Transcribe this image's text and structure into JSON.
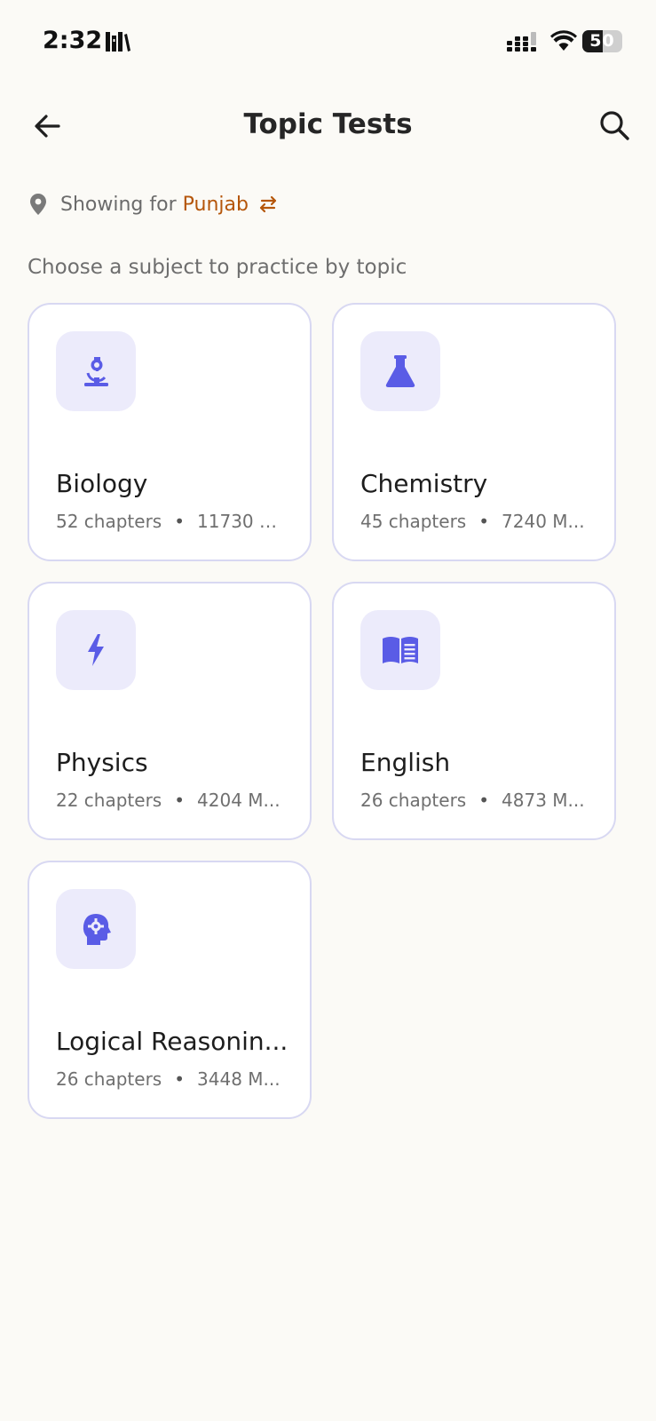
{
  "status_bar": {
    "time": "2:32",
    "battery": "50"
  },
  "header": {
    "title": "Topic Tests"
  },
  "location": {
    "prefix": "Showing for",
    "region": "Punjab"
  },
  "subtitle": "Choose a subject to practice by topic",
  "subjects": [
    {
      "name": "Biology",
      "chapters": "52 chapters",
      "mcqs": "11730 M...",
      "icon": "microscope-icon"
    },
    {
      "name": "Chemistry",
      "chapters": "45 chapters",
      "mcqs": "7240 M...",
      "icon": "flask-icon"
    },
    {
      "name": "Physics",
      "chapters": "22 chapters",
      "mcqs": "4204 M...",
      "icon": "lightning-icon"
    },
    {
      "name": "English",
      "chapters": "26 chapters",
      "mcqs": "4873 M...",
      "icon": "book-icon"
    },
    {
      "name": "Logical Reasonin...",
      "chapters": "26 chapters",
      "mcqs": "3448 M...",
      "icon": "brain-gear-icon"
    }
  ],
  "colors": {
    "accent": "#5a5ce6",
    "icon_bg": "#ecebfb",
    "location": "#b5560a",
    "card_border": "#d8d8f2",
    "background": "#fbfaf6"
  }
}
